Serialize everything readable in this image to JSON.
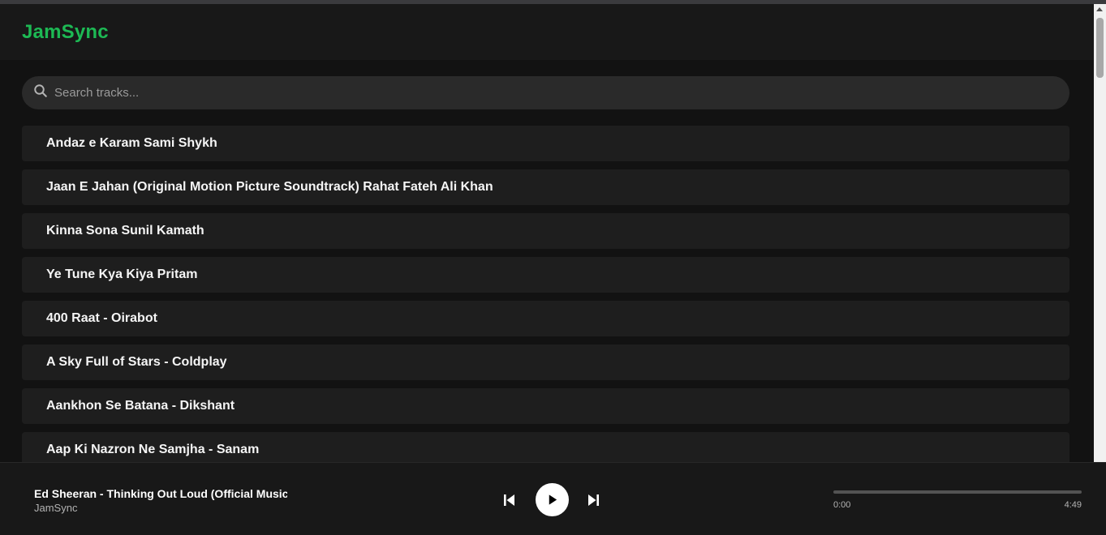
{
  "app": {
    "title": "JamSync"
  },
  "search": {
    "placeholder": "Search tracks..."
  },
  "tracks": [
    {
      "label": "Andaz e Karam Sami Shykh"
    },
    {
      "label": "Jaan E Jahan (Original Motion Picture Soundtrack) Rahat Fateh Ali Khan"
    },
    {
      "label": "Kinna Sona Sunil Kamath"
    },
    {
      "label": "Ye Tune Kya Kiya Pritam"
    },
    {
      "label": "400 Raat - Oirabot"
    },
    {
      "label": "A Sky Full of Stars - Coldplay"
    },
    {
      "label": "Aankhon Se Batana - Dikshant"
    },
    {
      "label": "Aap Ki Nazron Ne Samjha - Sanam"
    }
  ],
  "player": {
    "title": "Ed Sheeran - Thinking Out Loud (Official Music Video)",
    "artist": "JamSync",
    "elapsed": "0:00",
    "duration": "4:49",
    "progress": 0,
    "icons": {
      "prev": "skip-back-icon",
      "play": "play-icon",
      "next": "skip-forward-icon"
    }
  },
  "colors": {
    "accent": "#1db954",
    "background": "#121212",
    "surface": "#181818",
    "row": "#1e1e1e"
  }
}
